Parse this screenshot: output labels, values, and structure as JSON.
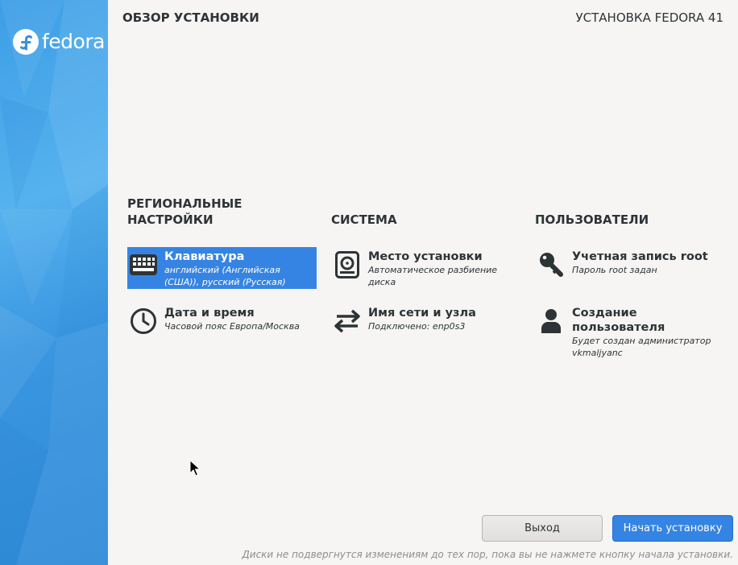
{
  "sidebar": {
    "logo_text": "fedora"
  },
  "header": {
    "title": "ОБЗОР УСТАНОВКИ",
    "product": "УСТАНОВКА FEDORA 41"
  },
  "categories": [
    {
      "heading": "РЕГИОНАЛЬНЫЕ НАСТРОЙКИ",
      "spokes": [
        {
          "icon": "keyboard-icon",
          "title": "Клавиатура",
          "status": "английский (Английская (США)), русский (Русская)",
          "selected": true
        },
        {
          "icon": "clock-icon",
          "title": "Дата и время",
          "status": "Часовой пояс Европа/Москва"
        }
      ]
    },
    {
      "heading": "СИСТЕМА",
      "spokes": [
        {
          "icon": "disk-icon",
          "title": "Место установки",
          "status": "Автоматическое разбиение диска"
        },
        {
          "icon": "network-arrows-icon",
          "title": "Имя сети и узла",
          "status": "Подключено: enp0s3"
        }
      ]
    },
    {
      "heading": "ПОЛЬЗОВАТЕЛИ",
      "spokes": [
        {
          "icon": "key-icon",
          "title": "Учетная запись root",
          "status": "Пароль root задан"
        },
        {
          "icon": "user-icon",
          "title": "Создание пользователя",
          "status": "Будет создан администратор vkmaljyanc"
        }
      ]
    }
  ],
  "buttons": {
    "quit": "Выход",
    "begin": "Начать установку"
  },
  "footer": {
    "note": "Диски не подвергнутся изменениям до тех пор, пока вы не нажмете кнопку начала установки."
  },
  "colors": {
    "accent": "#3584e4",
    "sidebar": "#3d9ee6",
    "background": "#f6f5f4"
  }
}
